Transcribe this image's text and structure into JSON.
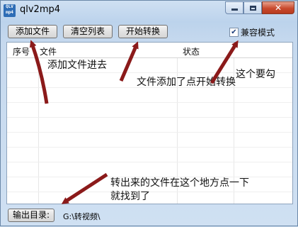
{
  "window": {
    "title": "qlv2mp4",
    "icon_text": "QLV mp4",
    "close_glyph": "✕"
  },
  "toolbar": {
    "add_file": "添加文件",
    "clear_list": "清空列表",
    "start_convert": "开始转换",
    "compat_mode_label": "兼容模式",
    "compat_mode_checked": true,
    "check_glyph": "✔"
  },
  "list": {
    "columns": [
      "序号",
      "文件",
      "状态"
    ]
  },
  "output": {
    "button_label": "输出目录:",
    "path": "G:\\转视频\\"
  },
  "annotations": {
    "add_file_here": "添加文件进去",
    "after_add_click_start": "文件添加了点开始转换",
    "must_check_this": "这个要勾",
    "output_note_line1": "转出来的文件在这个地方点一下",
    "output_note_line2": "就找到了",
    "arrow_color": "#8b1a1a"
  }
}
